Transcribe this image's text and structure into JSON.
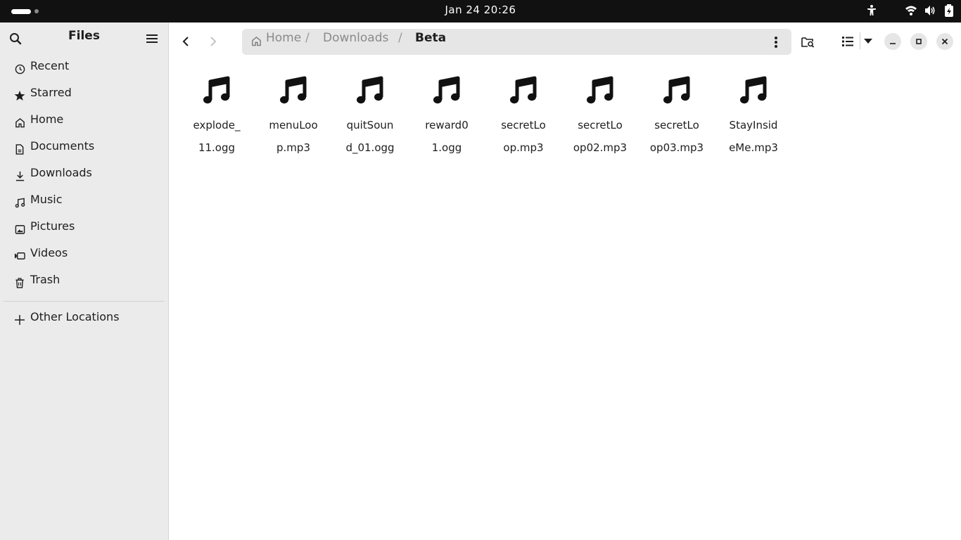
{
  "topbar": {
    "clock": "Jan 24  20:26"
  },
  "sidebar": {
    "title": "Files",
    "items": [
      {
        "label": "Recent",
        "icon": "clock-icon"
      },
      {
        "label": "Starred",
        "icon": "star-icon"
      },
      {
        "label": "Home",
        "icon": "home-icon"
      },
      {
        "label": "Documents",
        "icon": "document-icon"
      },
      {
        "label": "Downloads",
        "icon": "download-icon"
      },
      {
        "label": "Music",
        "icon": "music-icon"
      },
      {
        "label": "Pictures",
        "icon": "picture-icon"
      },
      {
        "label": "Videos",
        "icon": "video-icon"
      },
      {
        "label": "Trash",
        "icon": "trash-icon"
      }
    ],
    "other": {
      "label": "Other Locations",
      "icon": "plus-icon"
    }
  },
  "pathbar": {
    "crumbs": [
      "Home",
      "Downloads",
      "Beta"
    ],
    "separator": "/"
  },
  "files": [
    {
      "line1": "explode_",
      "line2": "11.ogg"
    },
    {
      "line1": "menuLoo",
      "line2": "p.mp3"
    },
    {
      "line1": "quitSoun",
      "line2": "d_01.ogg"
    },
    {
      "line1": "reward0",
      "line2": "1.ogg"
    },
    {
      "line1": "secretLo",
      "line2": "op.mp3"
    },
    {
      "line1": "secretLo",
      "line2": "op02.mp3"
    },
    {
      "line1": "secretLo",
      "line2": "op03.mp3"
    },
    {
      "line1": "StayInsid",
      "line2": "eMe.mp3"
    }
  ],
  "colors": {
    "topbar": "#111111",
    "sidebar": "#ebebeb",
    "pathbar": "#e6e6e6"
  }
}
